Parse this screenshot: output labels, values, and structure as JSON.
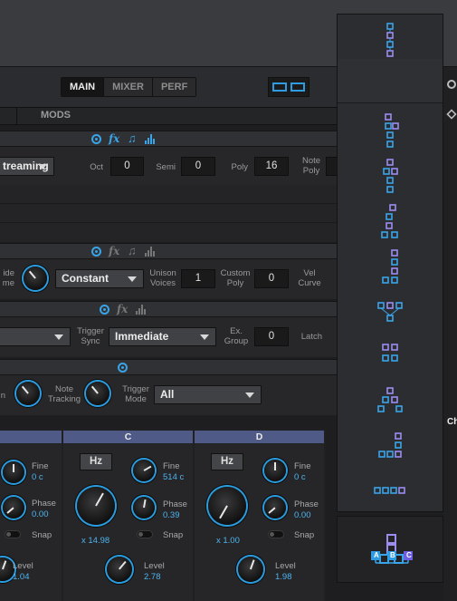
{
  "tabs": {
    "main": "MAIN",
    "mixer": "MIXER",
    "perf": "PERF",
    "mods": "MODS"
  },
  "voice": {
    "mode_value": "treaming",
    "oct_label": "Oct",
    "oct_value": "0",
    "semi_label": "Semi",
    "semi_value": "0",
    "poly_label": "Poly",
    "poly_value": "16",
    "note_poly_label": "Note\nPoly"
  },
  "glide": {
    "glide_label": "ide\nme",
    "mode_value": "Constant",
    "unison_label": "Unison\nVoices",
    "unison_value": "1",
    "custom_poly_label": "Custom\nPoly",
    "custom_poly_value": "0",
    "vel_curve_label": "Vel\nCurve"
  },
  "trigger": {
    "sync_label": "Trigger\nSync",
    "sync_value": "Immediate",
    "ex_group_label": "Ex.\nGroup",
    "ex_group_value": "0",
    "latch_label": "Latch"
  },
  "lfo": {
    "n_label": "n",
    "note_tracking_label": "Note\nTracking",
    "trigger_mode_label": "Trigger\nMode",
    "trigger_mode_value": "All"
  },
  "operators": [
    {
      "name": "",
      "fine_label": "Fine",
      "fine_value": "0 c",
      "phase_label": "Phase",
      "phase_value": "0.00",
      "snap_label": "Snap",
      "level_label": "Level",
      "level_value": "1.04"
    },
    {
      "name": "C",
      "hz": "Hz",
      "fine_label": "Fine",
      "fine_value": "514 c",
      "phase_label": "Phase",
      "phase_value": "0.39",
      "snap_label": "Snap",
      "mult": "x 14.98",
      "level_label": "Level",
      "level_value": "2.78"
    },
    {
      "name": "D",
      "hz": "Hz",
      "fine_label": "Fine",
      "fine_value": "0 c",
      "phase_label": "Phase",
      "phase_value": "0.00",
      "snap_label": "Snap",
      "mult": "x 1.00",
      "level_label": "Level",
      "level_value": "1.98"
    }
  ],
  "algorithm": {
    "selected_labels": [
      "A",
      "B",
      "C"
    ],
    "side_label": "Ch"
  },
  "colors": {
    "accent": "#2e9be3",
    "op_header": "#4f5a86",
    "alg_blue": "#3aa4e8",
    "alg_purple": "#9c8cf0"
  }
}
